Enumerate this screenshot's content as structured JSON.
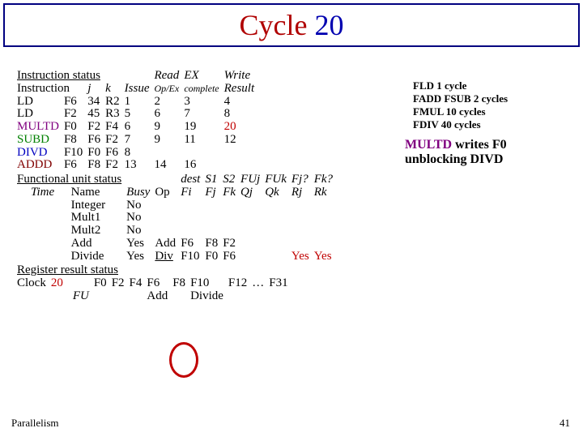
{
  "title": {
    "w1": "Cycle",
    "w2": "20"
  },
  "side_info": [
    "FLD    1 cycle",
    "FADD  FSUB 2 cycles",
    "FMUL 10 cycles",
    "FDIV   40 cycles"
  ],
  "note": {
    "l1a": "MULTD",
    "l1b": " writes  F0",
    "l2": "unblocking DIVD"
  },
  "inst_status_hdr": "Instruction status",
  "inst_headers": {
    "instr": "Instruction",
    "j": "j",
    "k": "k",
    "read": "Read",
    "ex": "EX",
    "write": "Write",
    "issue": "Issue",
    "opex": "Op/Ex",
    "complete": "complete",
    "result": "Result"
  },
  "inst_rows": [
    {
      "op": "LD",
      "d": "F6",
      "j": "34",
      "k": "R2",
      "issue": "1",
      "read": "2",
      "ex": "3",
      "wr": "4"
    },
    {
      "op": "LD",
      "d": "F2",
      "j": "45",
      "k": "R3",
      "issue": "5",
      "read": "6",
      "ex": "7",
      "wr": "8"
    },
    {
      "op": "MULTD",
      "d": "F0",
      "j": "F2",
      "k": "F4",
      "issue": "6",
      "read": "9",
      "ex": "19",
      "wr": "20",
      "wr_red": true
    },
    {
      "op": "SUBD",
      "d": "F8",
      "j": "F6",
      "k": "F2",
      "issue": "7",
      "read": "9",
      "ex": "11",
      "wr": "12"
    },
    {
      "op": "DIVD",
      "d": "F10",
      "j": "F0",
      "k": "F6",
      "issue": "8",
      "read": "",
      "ex": "",
      "wr": ""
    },
    {
      "op": "ADDD",
      "d": "F6",
      "j": "F8",
      "k": "F2",
      "issue": "13",
      "read": "14",
      "ex": "16",
      "wr": ""
    }
  ],
  "fu_status_hdr": "Functional unit status",
  "fu_headers": {
    "time": "Time",
    "name": "Name",
    "busy": "Busy",
    "op": "Op",
    "dest": "dest",
    "s1": "S1",
    "s2": "S2",
    "fuj": "FUj",
    "fuk": "FUk",
    "fjq": "Fj?",
    "fkq": "Fk?",
    "fi": "Fi",
    "fj": "Fj",
    "fk": "Fk",
    "qj": "Qj",
    "qk": "Qk",
    "rj": "Rj",
    "rk": "Rk"
  },
  "fu_rows": [
    {
      "name": "Integer",
      "busy": "No"
    },
    {
      "name": "Mult1",
      "busy": "No"
    },
    {
      "name": "Mult2",
      "busy": "No"
    },
    {
      "name": "Add",
      "busy": "Yes",
      "op": "Add",
      "fi": "F6",
      "fj": "F8",
      "fk": "F2",
      "qj": "",
      "qk": "",
      "rj": "",
      "rk": ""
    },
    {
      "name": "Divide",
      "busy": "Yes",
      "op": "Div",
      "fi": "F10",
      "fj": "F0",
      "fk": "F6",
      "qj": "",
      "qk": "",
      "rj": "Yes",
      "rk": "Yes"
    }
  ],
  "reg_status_hdr": "Register result status",
  "clock_label": "Clock",
  "clock_val": "20",
  "fu_label": "FU",
  "reg_headers": [
    "F0",
    "F2",
    "F4",
    "F6",
    "F8",
    "F10",
    "F12",
    "…",
    "F31"
  ],
  "reg_values": [
    "",
    "",
    "",
    "Add",
    "",
    "Divide",
    "",
    "",
    ""
  ],
  "footer_l": "Parallelism",
  "footer_r": "41"
}
